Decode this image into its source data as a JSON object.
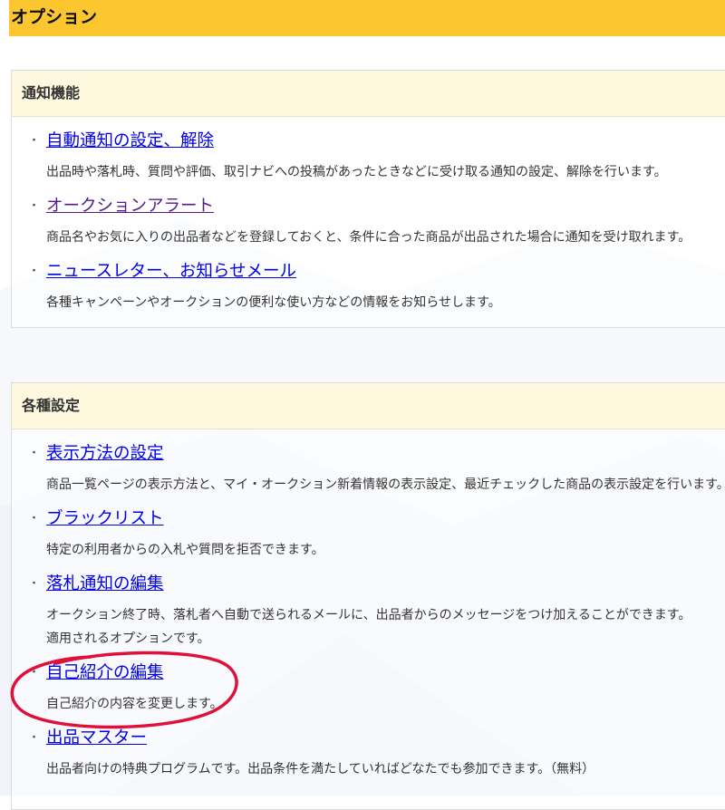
{
  "page": {
    "title": "オプション"
  },
  "notification_section": {
    "title": "通知機能",
    "items": [
      {
        "label": "自動通知の設定、解除",
        "visited": false,
        "description": "出品時や落札時、質問や評価、取引ナビへの投稿があったときなどに受け取る通知の設定、解除を行います。"
      },
      {
        "label": "オークションアラート",
        "visited": true,
        "description": "商品名やお気に入りの出品者などを登録しておくと、条件に合った商品が出品された場合に通知を受け取れます。"
      },
      {
        "label": "ニュースレター、お知らせメール",
        "visited": false,
        "description": "各種キャンペーンやオークションの便利な使い方などの情報をお知らせします。"
      }
    ]
  },
  "settings_section": {
    "title": "各種設定",
    "items": [
      {
        "label": "表示方法の設定",
        "visited": false,
        "description": "商品一覧ページの表示方法と、マイ・オークション新着情報の表示設定、最近チェックした商品の表示設定を行います。"
      },
      {
        "label": "ブラックリスト",
        "visited": false,
        "description": "特定の利用者からの入札や質問を拒否できます。"
      },
      {
        "label": "落札通知の編集",
        "visited": false,
        "description": "オークション終了時、落札者へ自動で送られるメールに、出品者からのメッセージをつけ加えることができます。\n適用されるオプションです。"
      },
      {
        "label": "自己紹介の編集",
        "visited": false,
        "description": "自己紹介の内容を変更します。"
      },
      {
        "label": "出品マスター",
        "visited": false,
        "description": "出品者向けの特典プログラムです。出品条件を満たしていればどなたでも参加できます。（無料）"
      }
    ]
  },
  "bullet_char": "・",
  "colors": {
    "header_bar": "#fbc62e",
    "section_header": "#fef8df",
    "link": "#0000ee",
    "visited_link": "#551a8b",
    "annotation": "#e0103a"
  }
}
